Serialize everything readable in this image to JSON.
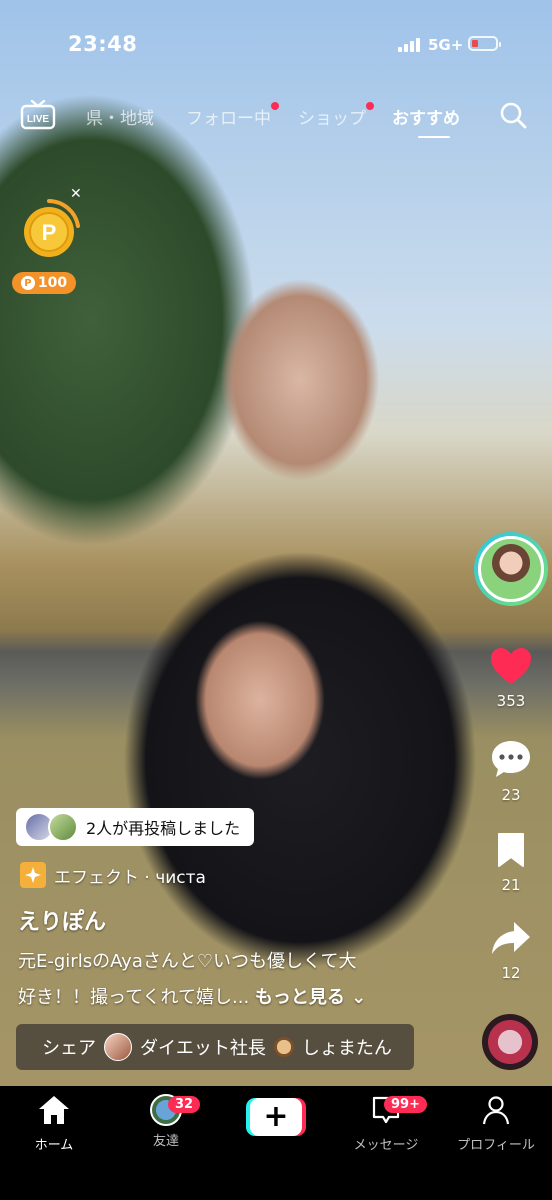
{
  "status": {
    "time": "23:48",
    "network": "5G+"
  },
  "nav": {
    "live_label": "LIVE",
    "tabs": [
      {
        "label": "県・地域",
        "dot": false
      },
      {
        "label": "フォロー中",
        "dot": true
      },
      {
        "label": "ショップ",
        "dot": true
      },
      {
        "label": "おすすめ",
        "dot": false,
        "active": true
      }
    ]
  },
  "reward": {
    "points": "100"
  },
  "actions": {
    "likes": "353",
    "comments": "23",
    "saves": "21",
    "shares": "12"
  },
  "post": {
    "repost_text": "2人が再投稿しました",
    "effect_text": "エフェクト · чиста",
    "author": "えりぽん",
    "caption_line1": "元E-girlsのAyaさんと♡いつも優しくて大",
    "caption_line2": "好き！！撮ってくれて嬉し... ",
    "more": "もっと見る",
    "share_prefix": "シェア",
    "share_name1": "ダイエット社長",
    "share_name2": "しょまたん"
  },
  "tabbar": {
    "home": "ホーム",
    "friends": "友達",
    "friends_badge": "32",
    "messages": "メッセージ",
    "messages_badge": "99+",
    "profile": "プロフィール"
  },
  "colors": {
    "accent": "#fe2c55",
    "cyan": "#25f4ee",
    "coin": "#f4922a"
  }
}
